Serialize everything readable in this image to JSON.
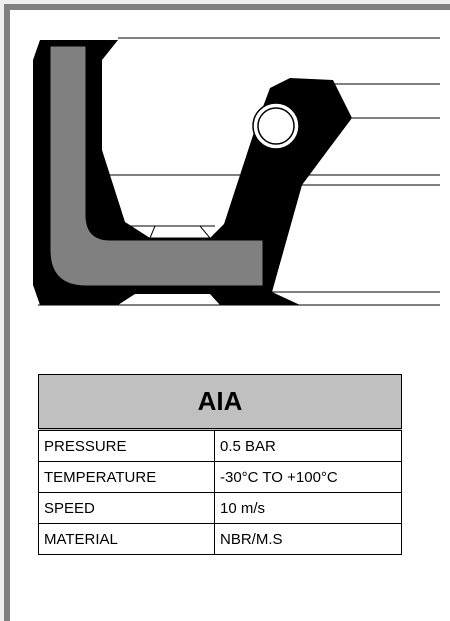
{
  "title": "AIA",
  "specs": [
    {
      "label": "PRESSURE",
      "value": "0.5 BAR"
    },
    {
      "label": "TEMPERATURE",
      "value": "-30°C  TO +100°C"
    },
    {
      "label": "SPEED",
      "value": "10 m/s"
    },
    {
      "label": "MATERIAL",
      "value": "NBR/M.S"
    }
  ],
  "colors": {
    "rubber": "#000000",
    "case": "#808080",
    "header_bg": "#c0c0c0",
    "frame": "#808080"
  }
}
